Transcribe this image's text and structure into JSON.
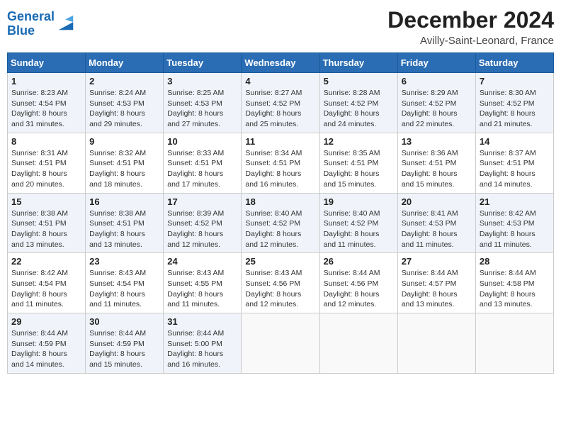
{
  "header": {
    "logo_line1": "General",
    "logo_line2": "Blue",
    "month_title": "December 2024",
    "location": "Avilly-Saint-Leonard, France"
  },
  "weekdays": [
    "Sunday",
    "Monday",
    "Tuesday",
    "Wednesday",
    "Thursday",
    "Friday",
    "Saturday"
  ],
  "weeks": [
    [
      {
        "day": "1",
        "sunrise": "8:23 AM",
        "sunset": "4:54 PM",
        "daylight": "8 hours and 31 minutes."
      },
      {
        "day": "2",
        "sunrise": "8:24 AM",
        "sunset": "4:53 PM",
        "daylight": "8 hours and 29 minutes."
      },
      {
        "day": "3",
        "sunrise": "8:25 AM",
        "sunset": "4:53 PM",
        "daylight": "8 hours and 27 minutes."
      },
      {
        "day": "4",
        "sunrise": "8:27 AM",
        "sunset": "4:52 PM",
        "daylight": "8 hours and 25 minutes."
      },
      {
        "day": "5",
        "sunrise": "8:28 AM",
        "sunset": "4:52 PM",
        "daylight": "8 hours and 24 minutes."
      },
      {
        "day": "6",
        "sunrise": "8:29 AM",
        "sunset": "4:52 PM",
        "daylight": "8 hours and 22 minutes."
      },
      {
        "day": "7",
        "sunrise": "8:30 AM",
        "sunset": "4:52 PM",
        "daylight": "8 hours and 21 minutes."
      }
    ],
    [
      {
        "day": "8",
        "sunrise": "8:31 AM",
        "sunset": "4:51 PM",
        "daylight": "8 hours and 20 minutes."
      },
      {
        "day": "9",
        "sunrise": "8:32 AM",
        "sunset": "4:51 PM",
        "daylight": "8 hours and 18 minutes."
      },
      {
        "day": "10",
        "sunrise": "8:33 AM",
        "sunset": "4:51 PM",
        "daylight": "8 hours and 17 minutes."
      },
      {
        "day": "11",
        "sunrise": "8:34 AM",
        "sunset": "4:51 PM",
        "daylight": "8 hours and 16 minutes."
      },
      {
        "day": "12",
        "sunrise": "8:35 AM",
        "sunset": "4:51 PM",
        "daylight": "8 hours and 15 minutes."
      },
      {
        "day": "13",
        "sunrise": "8:36 AM",
        "sunset": "4:51 PM",
        "daylight": "8 hours and 15 minutes."
      },
      {
        "day": "14",
        "sunrise": "8:37 AM",
        "sunset": "4:51 PM",
        "daylight": "8 hours and 14 minutes."
      }
    ],
    [
      {
        "day": "15",
        "sunrise": "8:38 AM",
        "sunset": "4:51 PM",
        "daylight": "8 hours and 13 minutes."
      },
      {
        "day": "16",
        "sunrise": "8:38 AM",
        "sunset": "4:51 PM",
        "daylight": "8 hours and 13 minutes."
      },
      {
        "day": "17",
        "sunrise": "8:39 AM",
        "sunset": "4:52 PM",
        "daylight": "8 hours and 12 minutes."
      },
      {
        "day": "18",
        "sunrise": "8:40 AM",
        "sunset": "4:52 PM",
        "daylight": "8 hours and 12 minutes."
      },
      {
        "day": "19",
        "sunrise": "8:40 AM",
        "sunset": "4:52 PM",
        "daylight": "8 hours and 11 minutes."
      },
      {
        "day": "20",
        "sunrise": "8:41 AM",
        "sunset": "4:53 PM",
        "daylight": "8 hours and 11 minutes."
      },
      {
        "day": "21",
        "sunrise": "8:42 AM",
        "sunset": "4:53 PM",
        "daylight": "8 hours and 11 minutes."
      }
    ],
    [
      {
        "day": "22",
        "sunrise": "8:42 AM",
        "sunset": "4:54 PM",
        "daylight": "8 hours and 11 minutes."
      },
      {
        "day": "23",
        "sunrise": "8:43 AM",
        "sunset": "4:54 PM",
        "daylight": "8 hours and 11 minutes."
      },
      {
        "day": "24",
        "sunrise": "8:43 AM",
        "sunset": "4:55 PM",
        "daylight": "8 hours and 11 minutes."
      },
      {
        "day": "25",
        "sunrise": "8:43 AM",
        "sunset": "4:56 PM",
        "daylight": "8 hours and 12 minutes."
      },
      {
        "day": "26",
        "sunrise": "8:44 AM",
        "sunset": "4:56 PM",
        "daylight": "8 hours and 12 minutes."
      },
      {
        "day": "27",
        "sunrise": "8:44 AM",
        "sunset": "4:57 PM",
        "daylight": "8 hours and 13 minutes."
      },
      {
        "day": "28",
        "sunrise": "8:44 AM",
        "sunset": "4:58 PM",
        "daylight": "8 hours and 13 minutes."
      }
    ],
    [
      {
        "day": "29",
        "sunrise": "8:44 AM",
        "sunset": "4:59 PM",
        "daylight": "8 hours and 14 minutes."
      },
      {
        "day": "30",
        "sunrise": "8:44 AM",
        "sunset": "4:59 PM",
        "daylight": "8 hours and 15 minutes."
      },
      {
        "day": "31",
        "sunrise": "8:44 AM",
        "sunset": "5:00 PM",
        "daylight": "8 hours and 16 minutes."
      },
      null,
      null,
      null,
      null
    ]
  ]
}
